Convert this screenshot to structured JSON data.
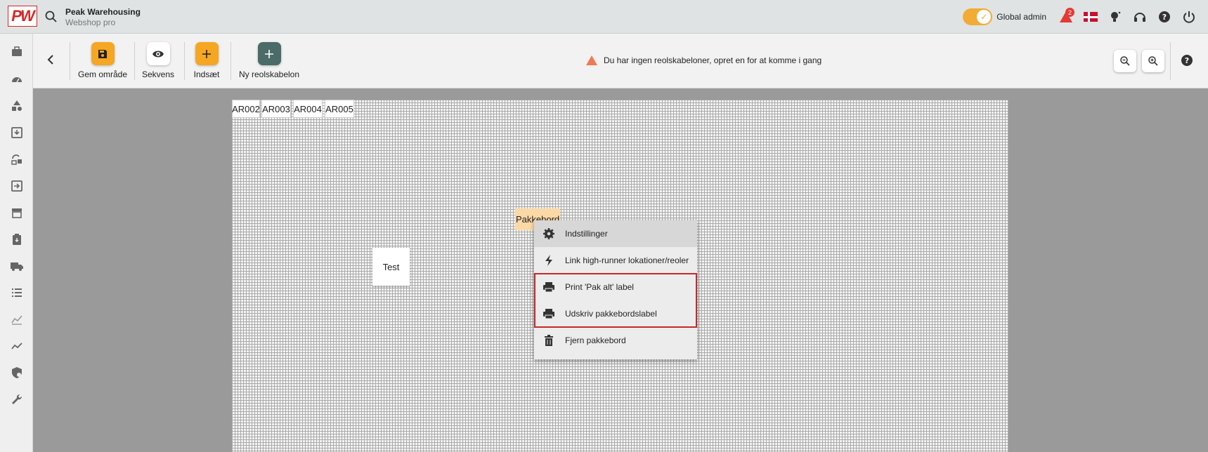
{
  "header": {
    "logo_text": "PW",
    "company_name": "Peak Warehousing",
    "company_sub": "Webshop pro",
    "admin_label": "Global admin",
    "notification_count": "2"
  },
  "sidebar": {
    "items": [
      {
        "icon": "briefcase-icon"
      },
      {
        "icon": "dashboard-icon"
      },
      {
        "icon": "shapes-icon"
      },
      {
        "icon": "inbox-icon"
      },
      {
        "icon": "returns-icon"
      },
      {
        "icon": "transfer-icon"
      },
      {
        "icon": "store-icon"
      },
      {
        "icon": "clipboard-icon"
      },
      {
        "icon": "truck-icon"
      },
      {
        "icon": "list-icon"
      },
      {
        "icon": "analytics-icon"
      },
      {
        "icon": "trend-icon"
      },
      {
        "icon": "shield-icon"
      },
      {
        "icon": "wrench-icon"
      }
    ]
  },
  "toolbar": {
    "save_label": "Gem område",
    "sequence_label": "Sekvens",
    "insert_label": "Indsæt",
    "new_template_label": "Ny reolskabelon",
    "warning_text": "Du har ingen reolskabeloner, opret en for at komme i gang"
  },
  "canvas": {
    "racks": [
      "AR002",
      "AR003",
      "AR004",
      "AR005"
    ],
    "test_label": "Test",
    "pakke_label": "Pakkebord"
  },
  "context_menu": {
    "items": [
      {
        "label": "Indstillinger",
        "icon": "gear-icon"
      },
      {
        "label": "Link high-runner lokationer/reoler",
        "icon": "lightning-icon"
      },
      {
        "label": "Print 'Pak alt' label",
        "icon": "printer-icon"
      },
      {
        "label": "Udskriv pakkebordslabel",
        "icon": "printer-icon"
      },
      {
        "label": "Fjern pakkebord",
        "icon": "trash-icon"
      }
    ]
  },
  "colors": {
    "accent_orange": "#f5a623",
    "teal": "#4a6b68",
    "highlight_red": "#c62828"
  }
}
